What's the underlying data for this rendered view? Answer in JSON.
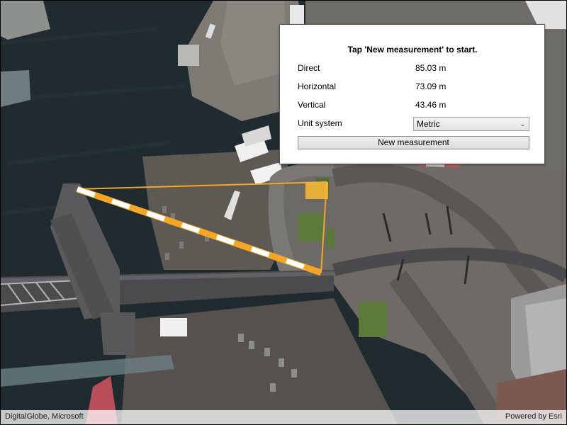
{
  "panel": {
    "instructions": "Tap 'New measurement' to start.",
    "direct_label": "Direct",
    "direct_value": "85.03 m",
    "horizontal_label": "Horizontal",
    "horizontal_value": "73.09 m",
    "vertical_label": "Vertical",
    "vertical_value": "43.46 m",
    "unit_system_label": "Unit system",
    "unit_system_selected": "Metric",
    "new_measurement_label": "New measurement"
  },
  "attribution": {
    "sources": "DigitalGlobe, Microsoft",
    "powered_by": "Powered by Esri"
  },
  "colors": {
    "measure_line": "#f5a623",
    "water": "#1d2a2e",
    "plaza": "#6b6762",
    "road": "#4a4a4c"
  }
}
